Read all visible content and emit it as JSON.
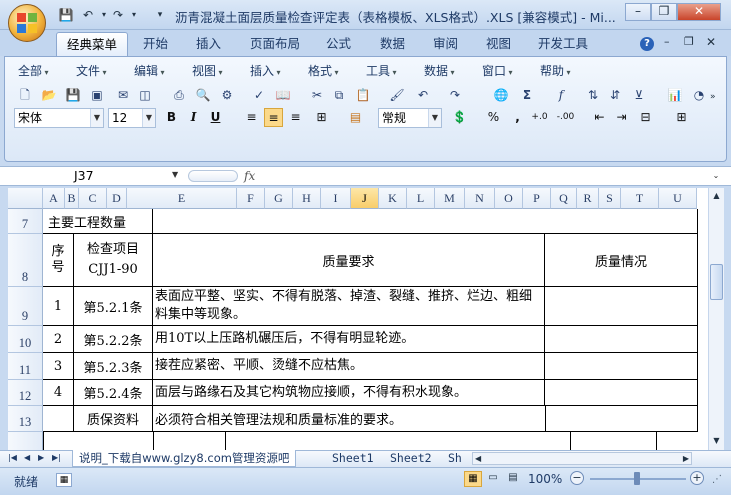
{
  "title_bar": {
    "title": "沥青混凝土面层质量检查评定表（表格模板、XLS格式）.XLS  [兼容模式] - Mi..."
  },
  "ribbon_tabs": [
    "经典菜单",
    "开始",
    "插入",
    "页面布局",
    "公式",
    "数据",
    "审阅",
    "视图",
    "开发工具"
  ],
  "classic_menu": [
    "全部",
    "文件",
    "编辑",
    "视图",
    "插入",
    "格式",
    "工具",
    "数据",
    "窗口",
    "帮助"
  ],
  "format_bar": {
    "font_name": "宋体",
    "font_size": "12",
    "bold": "B",
    "italic": "I",
    "underline": "U",
    "number_format": "常规",
    "percent": "%",
    "comma": ","
  },
  "formula_bar": {
    "name_box": "J37",
    "fx": "fx",
    "value": ""
  },
  "columns": [
    "A",
    "B",
    "C",
    "D",
    "E",
    "F",
    "G",
    "H",
    "I",
    "J",
    "K",
    "L",
    "M",
    "N",
    "O",
    "P",
    "Q",
    "R",
    "S",
    "T",
    "U"
  ],
  "active_column": "J",
  "rows": [
    "7",
    "8",
    "9",
    "10",
    "11",
    "12",
    "13"
  ],
  "sheet": {
    "section_title": "主要工程数量",
    "header": {
      "seq": "序号",
      "item": "检查项目",
      "item_code": "CJJ1-90",
      "requirement": "质量要求",
      "status": "质量情况"
    },
    "items": [
      {
        "seq": "1",
        "clause": "第5.2.1条",
        "requirement": "表面应平整、坚实、不得有脱落、掉渣、裂缝、推挤、烂边、粗细料集中等现象。"
      },
      {
        "seq": "2",
        "clause": "第5.2.2条",
        "requirement": "用10T以上压路机碾压后，不得有明显轮迹。"
      },
      {
        "seq": "3",
        "clause": "第5.2.3条",
        "requirement": "接茬应紧密、平顺、烫缝不应枯焦。"
      },
      {
        "seq": "4",
        "clause": "第5.2.4条",
        "requirement": "面层与路缘石及其它构筑物应接顺，不得有积水现象。"
      }
    ],
    "quality_docs": {
      "label": "质保资料",
      "requirement": "必须符合相关管理法规和质量标准的要求。"
    }
  },
  "sheet_tabs": [
    "说明_下载自www.glzy8.com管理资源吧",
    "Sheet1",
    "Sheet2",
    "Sh"
  ],
  "status_bar": {
    "status": "就绪",
    "zoom": "100%"
  }
}
